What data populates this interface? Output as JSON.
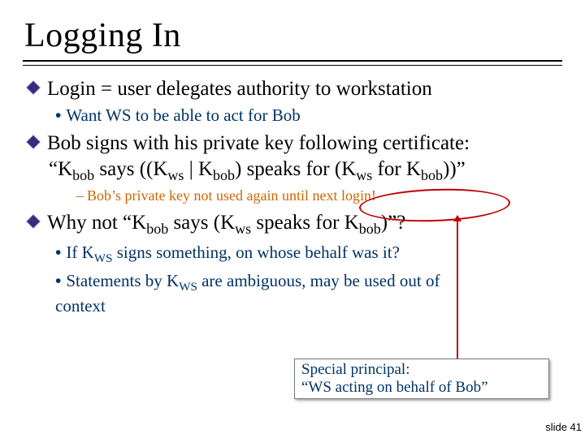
{
  "title": "Logging In",
  "bullets": {
    "b1": "Login = user delegates authority to workstation",
    "b1a": "Want WS to be able to act for Bob",
    "b2": "Bob signs with his private key following certificate:",
    "b2stmt_open": "“K",
    "b2stmt_1": " says ((K",
    "b2stmt_2": " | K",
    "b2stmt_3": ") speaks for (K",
    "b2stmt_4": " for K",
    "b2stmt_close": "))”",
    "b2a": "Bob’s private key not used again until next login!",
    "b3_open": "Why not “K",
    "b3_1": " says (K",
    "b3_2": " speaks for K",
    "b3_close": ")”?",
    "b3a_open": "If K",
    "b3a_rest": " signs something, on whose behalf was it?",
    "b3b_open": "Statements by K",
    "b3b_rest": " are ambiguous, may be used out of context"
  },
  "subs": {
    "bob": "bob",
    "ws": "ws",
    "WS": "WS"
  },
  "callout": {
    "line1": "Special principal:",
    "line2": "“WS acting on behalf of Bob”"
  },
  "footer": "slide 41",
  "bullet2": "•",
  "bullet3": "–"
}
